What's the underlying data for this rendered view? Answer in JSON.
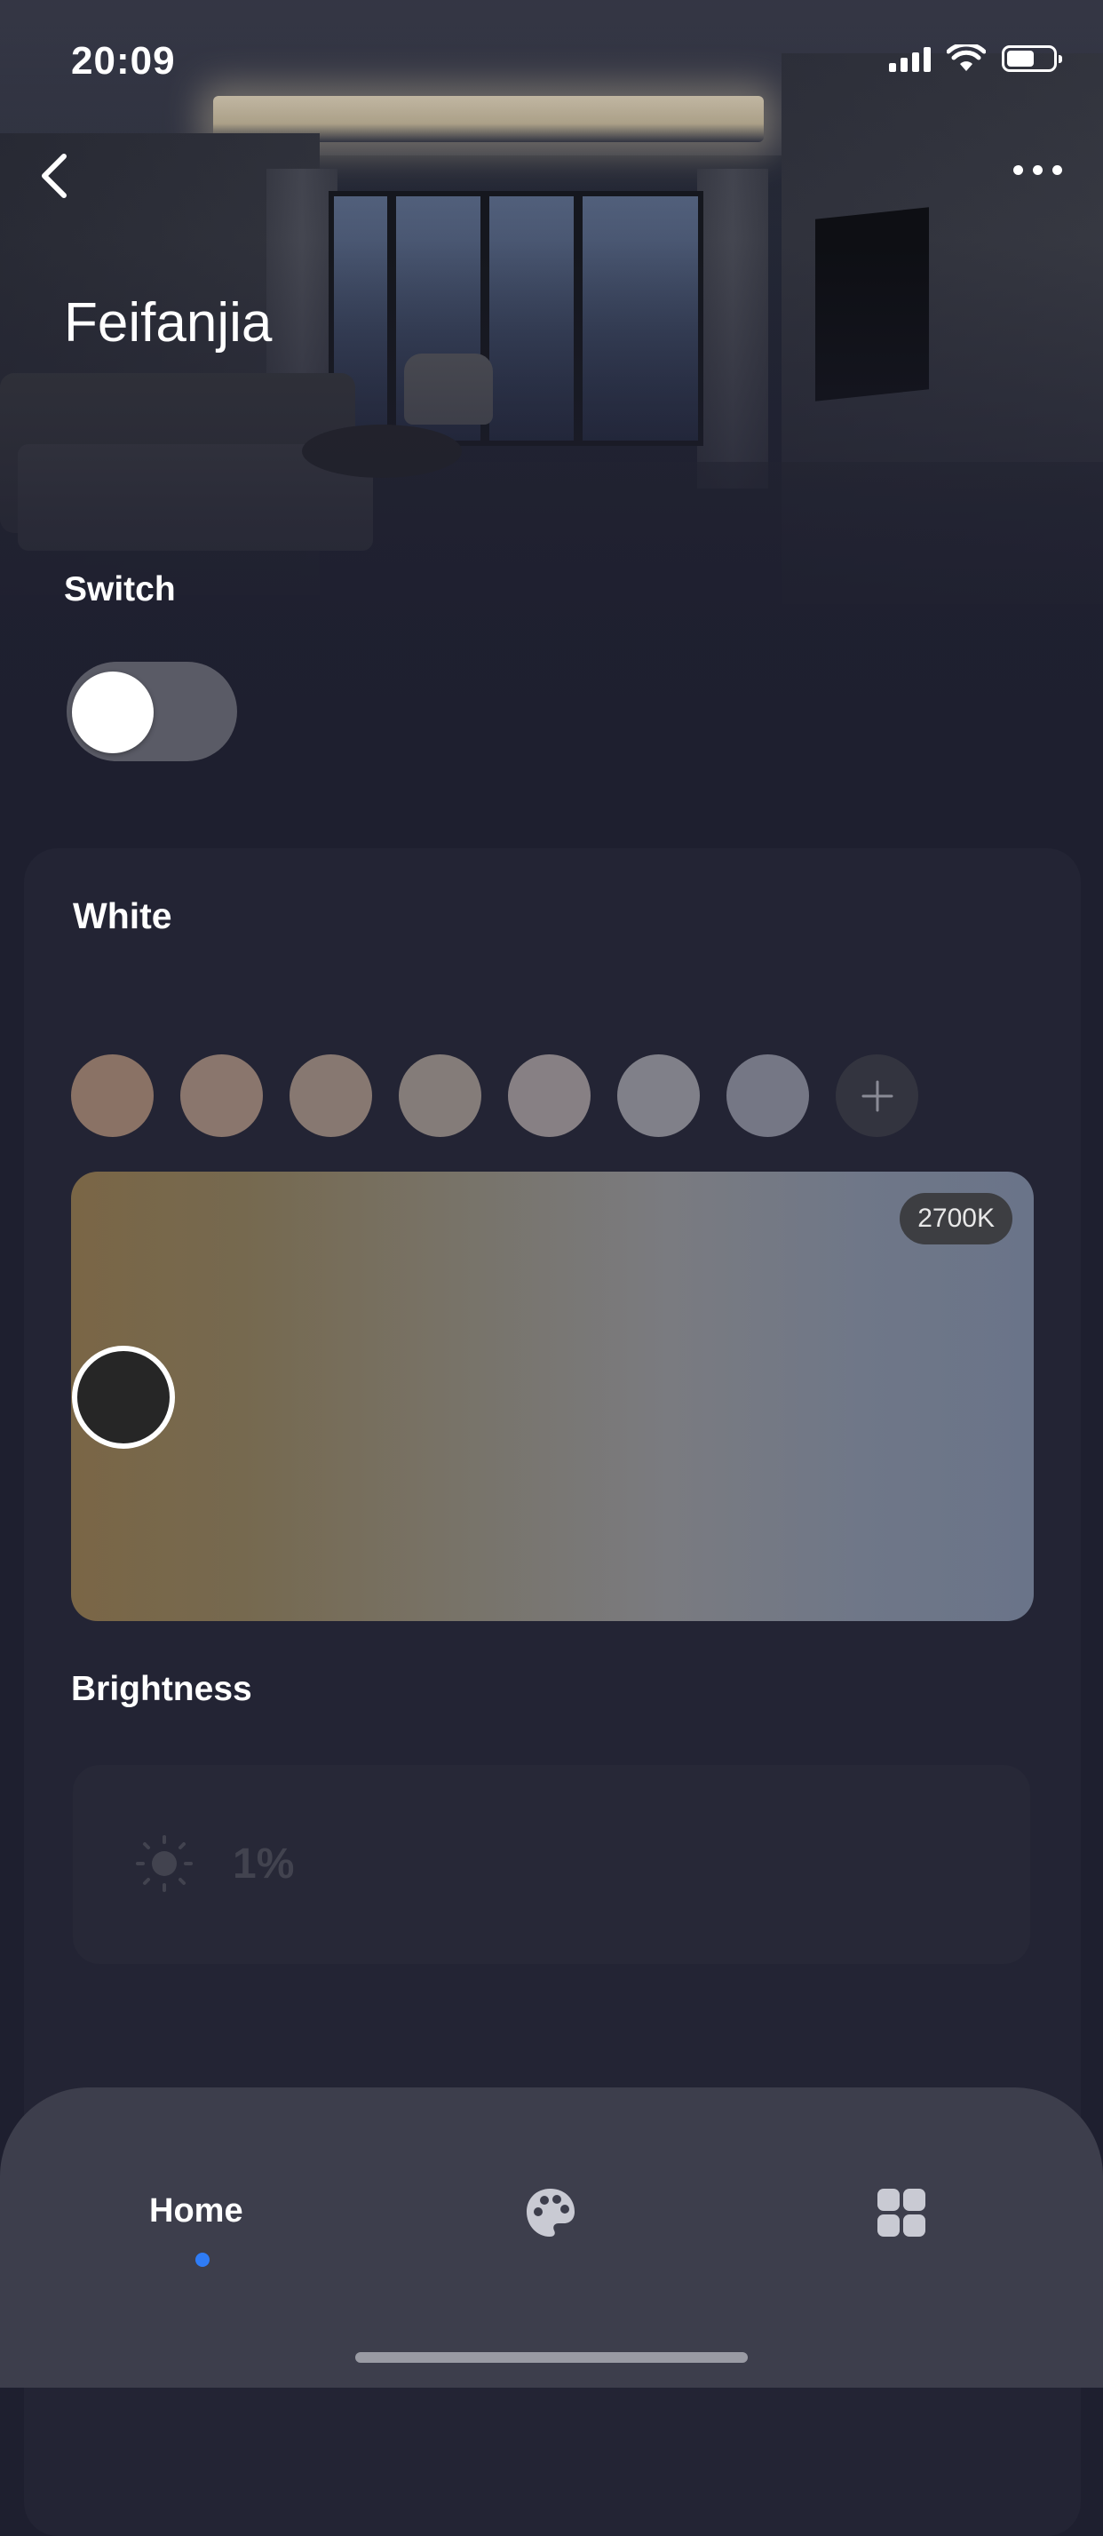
{
  "status_bar": {
    "time": "20:09"
  },
  "header": {
    "title": "Feifanjia"
  },
  "switch": {
    "label": "Switch",
    "state": "off"
  },
  "white": {
    "label": "White",
    "presets": [
      "#8a7265",
      "#8a766d",
      "#877871",
      "#847c79",
      "#878084",
      "#808089",
      "#757785"
    ],
    "temperature": "2700K"
  },
  "brightness": {
    "label": "Brightness",
    "value": "1%"
  },
  "nav": {
    "items": [
      {
        "label": "Home",
        "icon": "home",
        "active": true
      },
      {
        "label": "",
        "icon": "palette-icon",
        "active": false
      },
      {
        "label": "",
        "icon": "grid-icon",
        "active": false
      }
    ],
    "active_color": "#2f7cf6"
  }
}
